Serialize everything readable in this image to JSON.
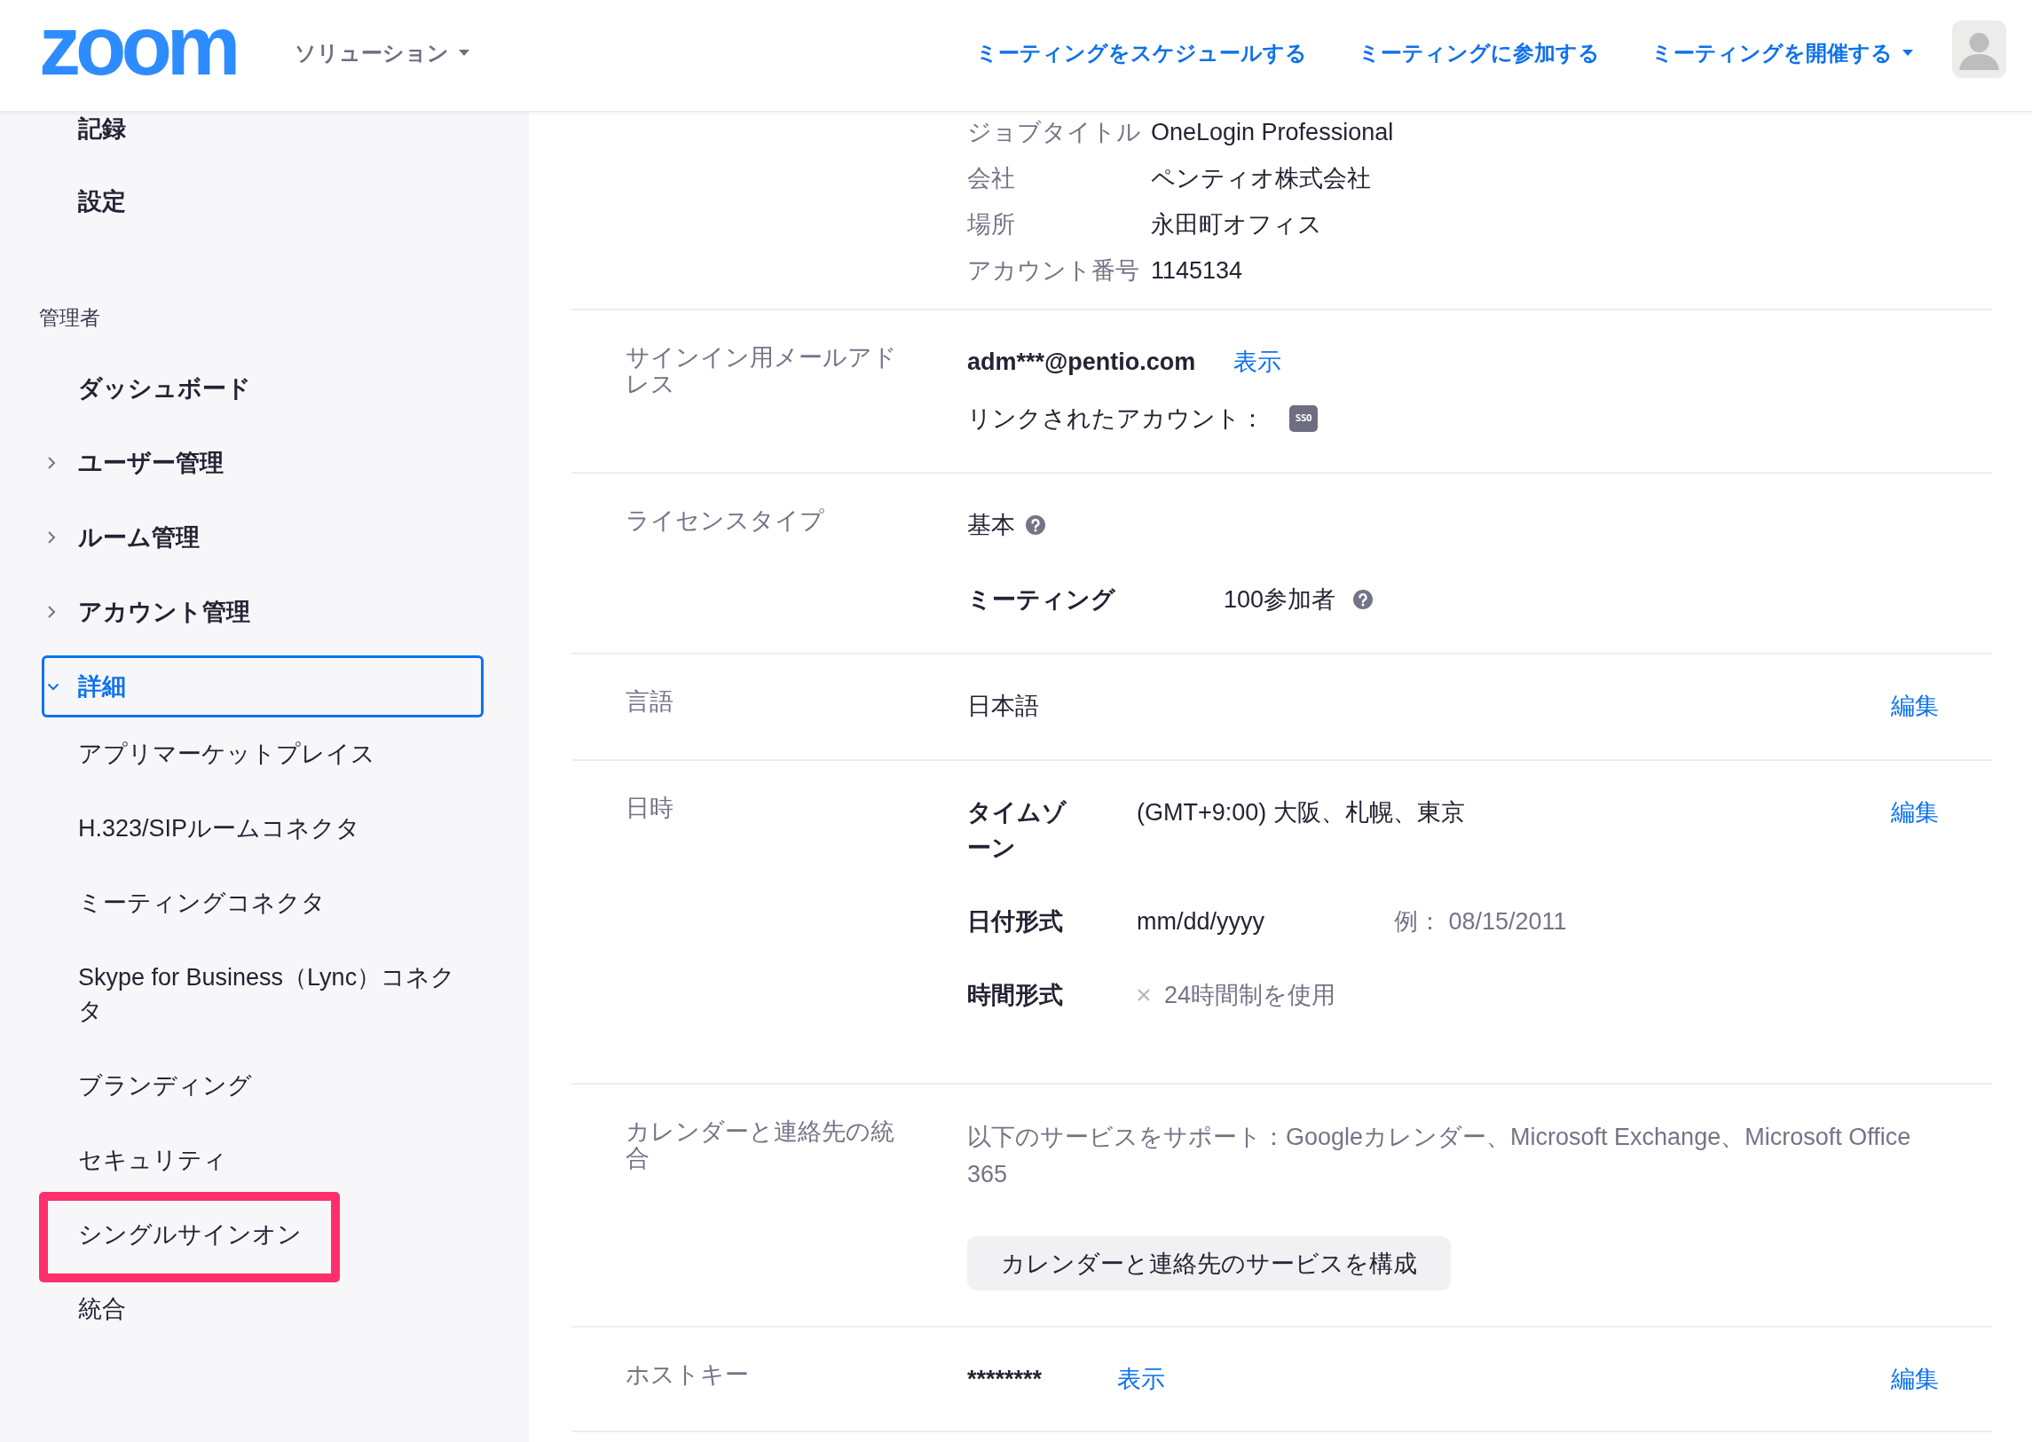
{
  "header": {
    "logo": "zoom",
    "solutions_menu": {
      "label": "ソリューション",
      "dropdown": true
    },
    "nav_links": [
      {
        "label": "ミーティングをスケジュールする",
        "dropdown": false
      },
      {
        "label": "ミーティングに参加する",
        "dropdown": false
      },
      {
        "label": "ミーティングを開催する",
        "dropdown": true
      }
    ]
  },
  "sidebar": {
    "sections": [
      {
        "items": [
          {
            "label": "記録",
            "kind": "link",
            "selected": false
          },
          {
            "label": "設定",
            "kind": "link",
            "selected": false
          }
        ]
      },
      {
        "title": "管理者",
        "items": [
          {
            "label": "ダッシュボード",
            "kind": "link",
            "selected": false
          },
          {
            "label": "ユーザー管理",
            "kind": "group",
            "expanded": false,
            "selected": false
          },
          {
            "label": "ルーム管理",
            "kind": "group",
            "expanded": false,
            "selected": false
          },
          {
            "label": "アカウント管理",
            "kind": "group",
            "expanded": false,
            "selected": false
          },
          {
            "label": "詳細",
            "kind": "group",
            "expanded": true,
            "selected": true,
            "children": [
              {
                "label": "アプリマーケットプレイス",
                "selected": false,
                "highlighted": false
              },
              {
                "label": "H.323/SIPルームコネクタ",
                "selected": false,
                "highlighted": false
              },
              {
                "label": "ミーティングコネクタ",
                "selected": false,
                "highlighted": false
              },
              {
                "label": "Skype for Business（Lync）コネクタ",
                "selected": false,
                "highlighted": false
              },
              {
                "label": "ブランディング",
                "selected": false,
                "highlighted": false
              },
              {
                "label": "セキュリティ",
                "selected": false,
                "highlighted": false
              },
              {
                "label": "シングルサインオン",
                "selected": false,
                "highlighted": true
              },
              {
                "label": "統合",
                "selected": false,
                "highlighted": false
              }
            ]
          }
        ]
      }
    ]
  },
  "profile": {
    "fields": [
      {
        "label": "ジョブタイトル",
        "value": "OneLogin Professional"
      },
      {
        "label": "会社",
        "value": "ペンティオ株式会社"
      },
      {
        "label": "場所",
        "value": "永田町オフィス"
      },
      {
        "label": "アカウント番号",
        "value": "1145134"
      }
    ]
  },
  "sections": [
    {
      "kind": "signin_email",
      "label": "サインイン用メールアドレス",
      "email": "adm***@pentio.com",
      "show_link": "表示",
      "linked_accounts_label": "リンクされたアカウント：",
      "linked_badge": "SSO"
    },
    {
      "kind": "license",
      "label": "ライセンスタイプ",
      "plan": "基本",
      "features": [
        {
          "name": "ミーティング",
          "value": "100参加者"
        }
      ]
    },
    {
      "kind": "language",
      "label": "言語",
      "value": "日本語",
      "edit_link": "編集"
    },
    {
      "kind": "datetime",
      "label": "日時",
      "edit_link": "編集",
      "settings": [
        {
          "kind": "timezone",
          "name": "タイムゾーン",
          "value": "(GMT+9:00) 大阪、札幌、東京"
        },
        {
          "kind": "date_format",
          "name": "日付形式",
          "value": "mm/dd/yyyy",
          "example": "例： 08/15/2011"
        },
        {
          "kind": "toggle",
          "name": "時間形式",
          "option": "24時間制を使用",
          "checked": false
        }
      ]
    },
    {
      "kind": "calendar",
      "label": "カレンダーと連絡先の統合",
      "description": "以下のサービスをサポート：Googleカレンダー、Microsoft Exchange、Microsoft Office 365",
      "button": "カレンダーと連絡先のサービスを構成"
    },
    {
      "kind": "host_key",
      "label": "ホストキー",
      "value": "********",
      "show_link": "表示",
      "edit_link": "編集"
    }
  ]
}
